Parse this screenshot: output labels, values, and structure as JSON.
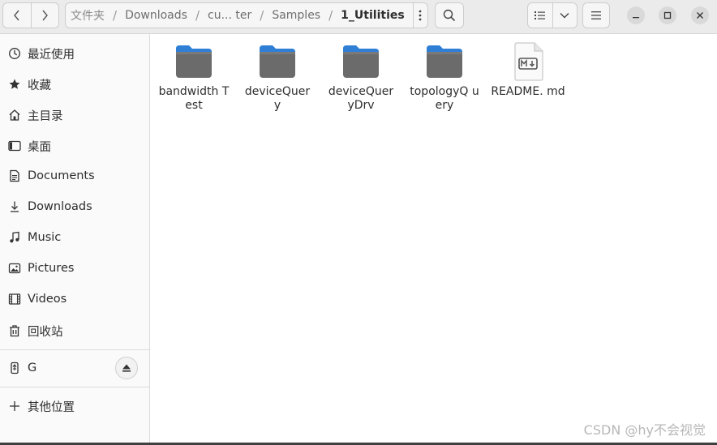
{
  "header": {
    "path": [
      {
        "label": "文件夹",
        "kind": "first"
      },
      {
        "label": "Downloads",
        "kind": "normal"
      },
      {
        "label": "cu... ter",
        "kind": "normal"
      },
      {
        "label": "Samples",
        "kind": "normal"
      },
      {
        "label": "1_Utilities",
        "kind": "current"
      }
    ],
    "separator": "/",
    "icons": {
      "back": "chevron-left-icon",
      "forward": "chevron-right-icon",
      "path_menu": "vertical-dots-icon",
      "search": "search-icon",
      "view_list": "list-view-icon",
      "view_dropdown": "chevron-down-icon",
      "main_menu": "hamburger-icon",
      "minimize": "minimize-icon",
      "maximize": "maximize-icon",
      "close": "close-icon"
    }
  },
  "sidebar": {
    "items": [
      {
        "label": "最近使用",
        "icon": "clock-icon"
      },
      {
        "label": "收藏",
        "icon": "star-icon"
      },
      {
        "label": "主目录",
        "icon": "home-icon"
      },
      {
        "label": "桌面",
        "icon": "desktop-icon"
      },
      {
        "label": "Documents",
        "icon": "document-icon"
      },
      {
        "label": "Downloads",
        "icon": "download-icon"
      },
      {
        "label": "Music",
        "icon": "music-icon"
      },
      {
        "label": "Pictures",
        "icon": "picture-icon"
      },
      {
        "label": "Videos",
        "icon": "video-icon"
      },
      {
        "label": "回收站",
        "icon": "trash-icon"
      }
    ],
    "drive": {
      "label": "G",
      "icon": "usb-drive-icon",
      "eject_icon": "eject-icon"
    },
    "other": {
      "label": "其他位置",
      "icon": "plus-icon"
    }
  },
  "files": [
    {
      "name": "bandwidth Test",
      "type": "folder"
    },
    {
      "name": "deviceQuer y",
      "type": "folder"
    },
    {
      "name": "deviceQuer yDrv",
      "type": "folder"
    },
    {
      "name": "topologyQ uery",
      "type": "folder"
    },
    {
      "name": "README. md",
      "type": "markdown"
    }
  ],
  "watermark": "CSDN @hy不会视觉",
  "colors": {
    "folder_top": "#2f7fd6",
    "folder_body": "#6b6b6b",
    "header_bg": "#ebebeb",
    "sidebar_bg": "#fafafa"
  }
}
